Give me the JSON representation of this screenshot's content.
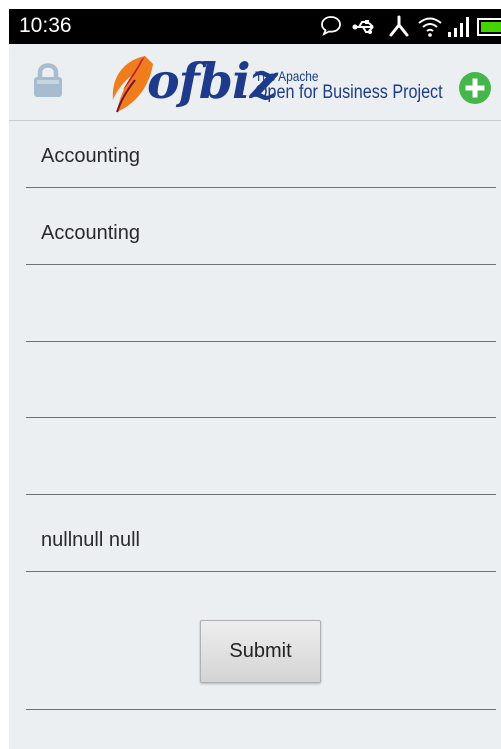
{
  "status_bar": {
    "time": "10:36"
  },
  "action_bar": {
    "logo_word": "ofbiz",
    "logo_tagline_1": "The Apache",
    "logo_tagline_2": "Open for Business Project",
    "lock_icon": "lock-icon",
    "add_icon": "plus-circle-icon"
  },
  "form": {
    "fields": [
      {
        "value": "Accounting"
      },
      {
        "value": "Accounting"
      },
      {
        "value": ""
      },
      {
        "value": ""
      },
      {
        "value": ""
      },
      {
        "value": "nullnull null"
      }
    ],
    "submit_label": "Submit"
  },
  "colors": {
    "background": "#eceff2",
    "logo_blue": "#1d3b8a",
    "add_green": "#45b649",
    "status_green": "#44d400"
  }
}
